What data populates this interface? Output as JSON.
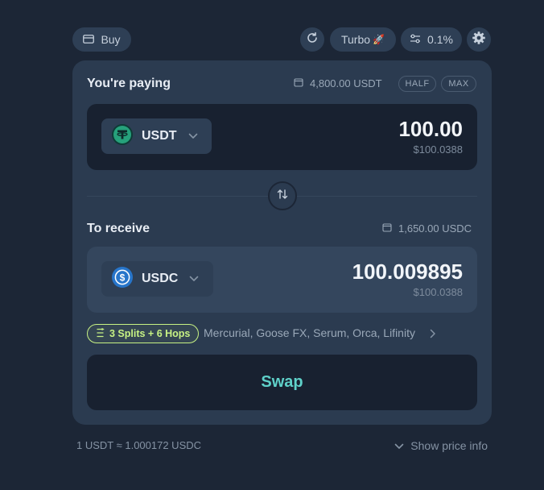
{
  "header": {
    "buy_label": "Buy",
    "turbo_label": "Turbo",
    "turbo_emoji": "🚀",
    "slippage_label": "0.1%"
  },
  "paying": {
    "label": "You're paying",
    "balance": "4,800.00 USDT",
    "half_label": "HALF",
    "max_label": "MAX",
    "token": "USDT",
    "amount": "100.00",
    "usd_value": "$100.0388"
  },
  "receive": {
    "label": "To receive",
    "balance": "1,650.00 USDC",
    "token": "USDC",
    "amount": "100.009895",
    "usd_value": "$100.0388"
  },
  "route": {
    "badge": "3 Splits + 6 Hops",
    "dexes": "Mercurial, Goose FX, Serum, Orca, Lifinity"
  },
  "swap_label": "Swap",
  "footer": {
    "rate": "1 USDT ≈ 1.000172 USDC",
    "price_info": "Show price info"
  },
  "colors": {
    "background": "#1c2636",
    "card": "#2b3b50",
    "route_accent": "#c7f284",
    "swap_text": "#5fd1c9",
    "usdt_brand": "#26a17b",
    "usdc_brand": "#2775ca"
  },
  "icons": {
    "buy": "card-icon",
    "refresh": "refresh-icon",
    "slippage": "sliders-icon",
    "settings": "gear-icon",
    "wallet": "wallet-icon",
    "swap_toggle": "swap-arrows-icon",
    "chevron": "chevron-down-icon"
  }
}
